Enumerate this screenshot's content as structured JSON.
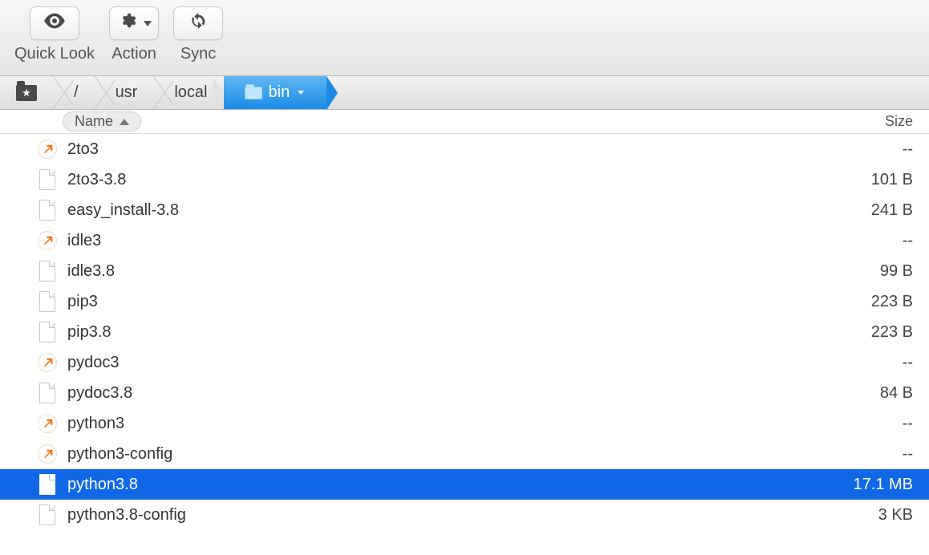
{
  "toolbar": {
    "quicklook_label": "Quick Look",
    "action_label": "Action",
    "sync_label": "Sync"
  },
  "path": {
    "segments": [
      "/",
      "usr",
      "local"
    ],
    "current": "bin"
  },
  "columns": {
    "name": "Name",
    "size": "Size"
  },
  "files": [
    {
      "name": "2to3",
      "size": "--",
      "type": "link",
      "selected": false
    },
    {
      "name": "2to3-3.8",
      "size": "101 B",
      "type": "file",
      "selected": false
    },
    {
      "name": "easy_install-3.8",
      "size": "241 B",
      "type": "file",
      "selected": false
    },
    {
      "name": "idle3",
      "size": "--",
      "type": "link",
      "selected": false
    },
    {
      "name": "idle3.8",
      "size": "99 B",
      "type": "file",
      "selected": false
    },
    {
      "name": "pip3",
      "size": "223 B",
      "type": "file",
      "selected": false
    },
    {
      "name": "pip3.8",
      "size": "223 B",
      "type": "file",
      "selected": false
    },
    {
      "name": "pydoc3",
      "size": "--",
      "type": "link",
      "selected": false
    },
    {
      "name": "pydoc3.8",
      "size": "84 B",
      "type": "file",
      "selected": false
    },
    {
      "name": "python3",
      "size": "--",
      "type": "link",
      "selected": false
    },
    {
      "name": "python3-config",
      "size": "--",
      "type": "link",
      "selected": false
    },
    {
      "name": "python3.8",
      "size": "17.1 MB",
      "type": "file",
      "selected": true
    },
    {
      "name": "python3.8-config",
      "size": "3 KB",
      "type": "file",
      "selected": false
    }
  ]
}
